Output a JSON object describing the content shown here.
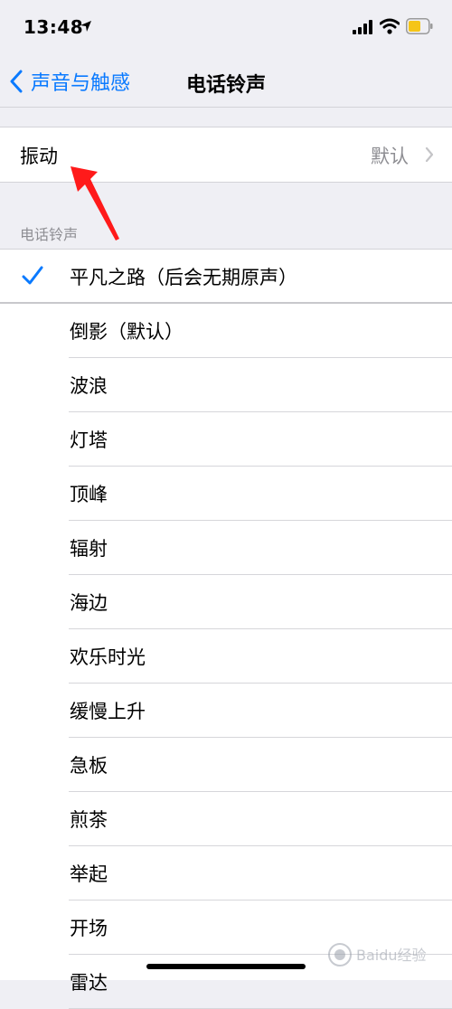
{
  "status_bar": {
    "time": "13:48",
    "icons": [
      "location-icon",
      "signal-icon",
      "wifi-icon",
      "battery-icon"
    ],
    "battery_color": "#f5c518"
  },
  "nav": {
    "back_label": "声音与触感",
    "title": "电话铃声",
    "accent_color": "#0a7aff"
  },
  "vibration": {
    "label": "振动",
    "value": "默认"
  },
  "ringtones": {
    "section_header": "电话铃声",
    "items": [
      {
        "label": "平凡之路（后会无期原声）",
        "selected": true
      },
      {
        "label": "倒影（默认）",
        "selected": false
      },
      {
        "label": "波浪",
        "selected": false
      },
      {
        "label": "灯塔",
        "selected": false
      },
      {
        "label": "顶峰",
        "selected": false
      },
      {
        "label": "辐射",
        "selected": false
      },
      {
        "label": "海边",
        "selected": false
      },
      {
        "label": "欢乐时光",
        "selected": false
      },
      {
        "label": "缓慢上升",
        "selected": false
      },
      {
        "label": "急板",
        "selected": false
      },
      {
        "label": "煎茶",
        "selected": false
      },
      {
        "label": "举起",
        "selected": false
      },
      {
        "label": "开场",
        "selected": false
      },
      {
        "label": "雷达",
        "selected": false
      }
    ]
  },
  "annotation": {
    "arrow_color": "#ff1a1a"
  },
  "watermark": {
    "text": "Baidu经验"
  }
}
